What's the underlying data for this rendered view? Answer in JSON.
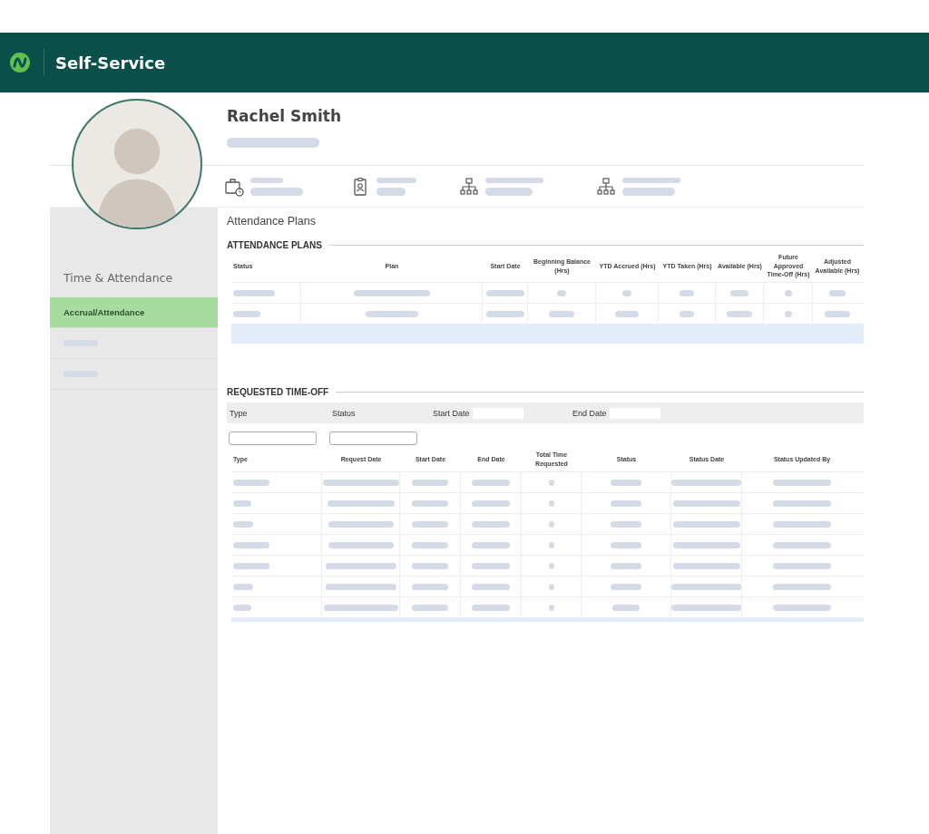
{
  "header": {
    "title": "Self-Service"
  },
  "profile": {
    "name": "Rachel Smith"
  },
  "sidebar": {
    "section_title": "Time & Attendance",
    "items": [
      {
        "kind": "text",
        "label": "Accrual/Attendance",
        "selected": true
      },
      {
        "kind": "skeleton",
        "selected": false
      },
      {
        "kind": "skeleton",
        "selected": false
      }
    ]
  },
  "page_title": "Attendance Plans",
  "attendance_plans": {
    "title": "ATTENDANCE PLANS",
    "columns": [
      "Status",
      "Plan",
      "Start Date",
      "Beginning Balance (Hrs)",
      "YTD Accrued (Hrs)",
      "YTD Taken (Hrs)",
      "Available (Hrs)",
      "Future Approved Time-Off (Hrs)",
      "Adjusted Available (Hrs)"
    ]
  },
  "requested_time_off": {
    "title": "REQUESTED TIME-OFF",
    "filters": [
      {
        "label": "Type",
        "kind": "below"
      },
      {
        "label": "Status",
        "kind": "below"
      },
      {
        "label": "Start Date",
        "kind": "inline"
      },
      {
        "label": "End Date",
        "kind": "inline"
      }
    ],
    "columns": [
      "Type",
      "Request Date",
      "Start Date",
      "End Date",
      "Total Time Requested",
      "Status",
      "Status Date",
      "Status Updated By"
    ]
  }
}
